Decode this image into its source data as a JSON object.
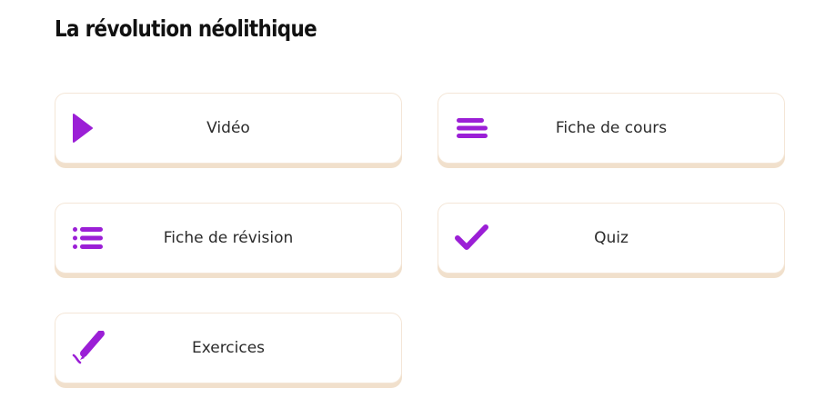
{
  "page": {
    "title": "La révolution néolithique"
  },
  "colors": {
    "accent": "#9b1fd6",
    "card_border": "#f4e6d7",
    "card_shadow": "#f1e0cc",
    "text": "#2b2b2b",
    "title": "#111111"
  },
  "cards": [
    {
      "label": "Vidéo",
      "icon": "play-icon"
    },
    {
      "label": "Fiche de cours",
      "icon": "text-lines-icon"
    },
    {
      "label": "Fiche de révision",
      "icon": "list-icon"
    },
    {
      "label": "Quiz",
      "icon": "checkmark-icon"
    },
    {
      "label": "Exercices",
      "icon": "pencil-icon"
    }
  ]
}
